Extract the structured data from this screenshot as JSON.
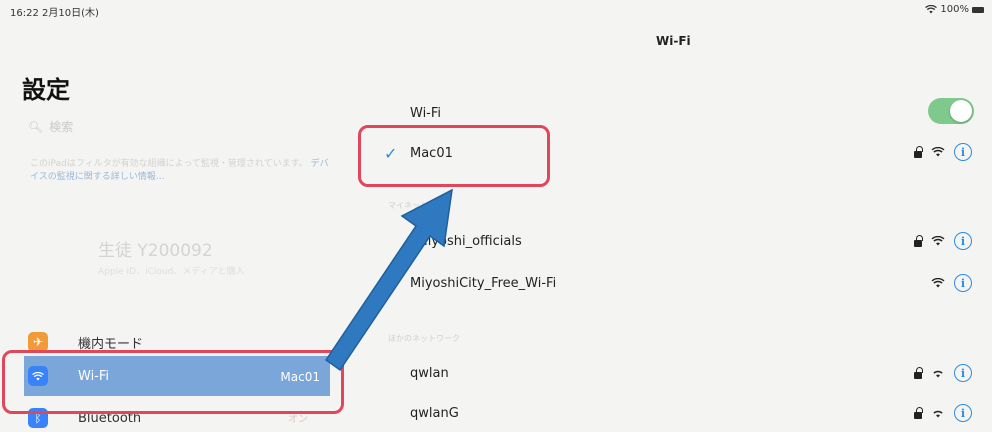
{
  "status_bar": {
    "time_date": "16:22  2月10日(木)",
    "battery": "100%"
  },
  "sidebar": {
    "title": "設定",
    "search_placeholder": "検索",
    "info_text": "このiPadはフィルタが有効な組織によって監視・管理されています。",
    "info_link": "デバイスの監視に関する詳しい情報…",
    "profile_name": "生徒 Y200092",
    "profile_sub": "Apple ID、iCloud、メディアと購入",
    "items": [
      {
        "label": "機内モード",
        "icon": "airplane-icon",
        "color": "#f19a38"
      },
      {
        "label": "Wi-Fi",
        "value": "Mac01",
        "icon": "wifi-icon",
        "color": "#3a82f7"
      },
      {
        "label": "Bluetooth",
        "value": "オン",
        "icon": "bluetooth-icon",
        "color": "#3a82f7"
      }
    ]
  },
  "detail": {
    "title": "Wi-Fi",
    "wifi_label": "Wi-Fi",
    "connected": {
      "name": "Mac01",
      "checkmark": "✓"
    },
    "my_networks_header": "マイネットワーク",
    "my_networks": [
      {
        "name": "_Miyoshi_officials",
        "locked": true
      },
      {
        "name": "MiyoshiCity_Free_Wi-Fi",
        "locked": false
      }
    ],
    "other_networks_header": "ほかのネットワーク",
    "other_networks": [
      {
        "name": "qwlan",
        "locked": true
      },
      {
        "name": "qwlanG",
        "locked": true
      }
    ],
    "info_glyph": "i"
  },
  "colors": {
    "annotation_red": "#e0475a",
    "annotation_arrow": "#2f79c0",
    "toggle_on": "#7fc98c",
    "accent": "#2e8ce0"
  }
}
